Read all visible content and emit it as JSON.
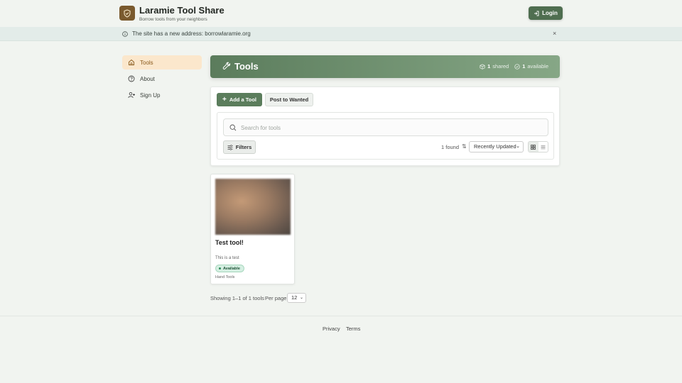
{
  "header": {
    "brand_title": "Laramie Tool Share",
    "brand_subtitle": "Borrow tools from your neighbors",
    "login_label": "Login"
  },
  "banner": {
    "message": "The site has a new address: borrowlaramie.org",
    "close_glyph": "×"
  },
  "sidebar": {
    "items": [
      {
        "label": "Tools",
        "icon": "home-icon",
        "active": true
      },
      {
        "label": "About",
        "icon": "help-circle-icon",
        "active": false
      },
      {
        "label": "Sign Up",
        "icon": "user-plus-icon",
        "active": false
      }
    ]
  },
  "hero": {
    "title": "Tools",
    "shared_count": "1",
    "shared_label": "shared",
    "available_count": "1",
    "available_label": "available"
  },
  "actions": {
    "add_tool_label": "Add a Tool",
    "post_wanted_label": "Post to Wanted"
  },
  "search": {
    "placeholder": "Search for tools",
    "filters_label": "Filters",
    "found_text": "1 found",
    "sort_selected": "Recently Updated"
  },
  "tools": [
    {
      "title": "Test tool!",
      "description": "This is a test",
      "status": "Available",
      "category": "Hand Tools"
    }
  ],
  "pagination": {
    "showing_text": "Showing 1–1 of 1 tools",
    "per_page_label": "Per page",
    "per_page_value": "12"
  },
  "footer": {
    "privacy_label": "Privacy",
    "terms_label": "Terms"
  },
  "colors": {
    "accent": "#4f6e50",
    "active_nav_bg": "#fbe7cc",
    "logo_bg": "#7a5a2e",
    "badge_bg": "#d5efe2"
  }
}
